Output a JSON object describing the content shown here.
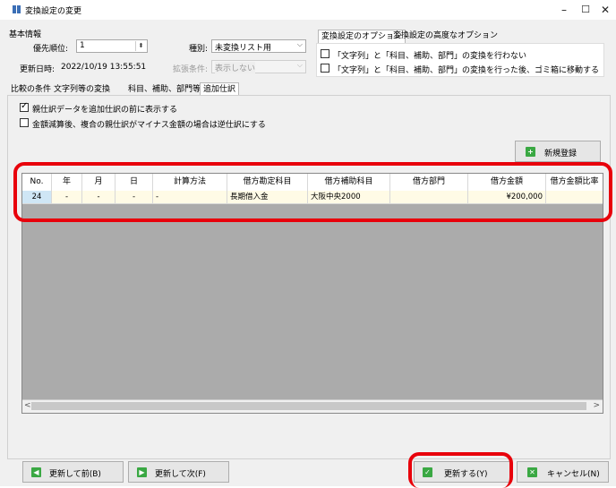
{
  "window": {
    "title": "変換設定の変更",
    "minimize": "–",
    "maximize": "☐",
    "close": "✕"
  },
  "basic": {
    "group_label": "基本情報",
    "priority_label": "優先順位:",
    "priority_value": "1",
    "kind_label": "種別:",
    "kind_value": "未変換リスト用",
    "updated_label": "更新日時:",
    "updated_value": "2022/10/19 13:55:51",
    "extended_label": "拡張条件:",
    "extended_value": "表示しない"
  },
  "option_tabs": [
    {
      "label": "変換設定のオプション"
    },
    {
      "label": "変換設定の高度なオプション"
    }
  ],
  "options": [
    {
      "label": "「文字列」と「科目、補助、部門」の変換を行わない",
      "checked": false
    },
    {
      "label": "「文字列」と「科目、補助、部門」の変換を行った後、ゴミ箱に移動する",
      "checked": false
    }
  ],
  "main_tabs": [
    {
      "label": "比較の条件"
    },
    {
      "label": "文字列等の変換"
    },
    {
      "label": "科目、補助、部門等"
    },
    {
      "label": "追加仕訳"
    }
  ],
  "additional": {
    "chk1": {
      "label": "親仕訳データを追加仕訳の前に表示する",
      "checked": true
    },
    "chk2": {
      "label": "金額減算後、複合の親仕訳がマイナス金額の場合は逆仕訳にする",
      "checked": false
    },
    "new_button": "新規登録"
  },
  "table": {
    "columns": [
      "No.",
      "年",
      "月",
      "日",
      "計算方法",
      "借方勘定科目",
      "借方補助科目",
      "借方部門",
      "借方金額",
      "借方金額比率"
    ],
    "rows": [
      [
        "24",
        "-",
        "-",
        "-",
        "-",
        "長期借入金",
        "大阪中央2000",
        "",
        "¥200,000",
        ""
      ]
    ]
  },
  "footer": {
    "prev_button": "更新して前(B)",
    "next_button": "更新して次(F)",
    "update_button": "更新する(Y)",
    "cancel_button": "キャンセル(N)"
  },
  "colors": {
    "highlight": "#e8000b",
    "icon_green": "#3aa843",
    "title_icon": "#3b6fb6",
    "grid_empty": "#ababab",
    "selected_row": "#fffbe6"
  }
}
